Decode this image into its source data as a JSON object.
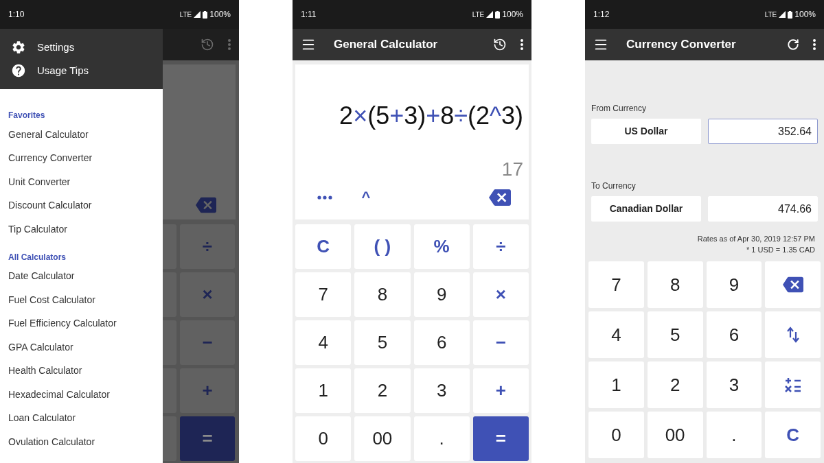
{
  "screens": [
    {
      "kind": "drawer",
      "status_bar": {
        "time": "1:10",
        "network": "LTE",
        "battery": "100%"
      },
      "drawer": {
        "top_items": [
          {
            "label": "Settings",
            "kind": "settings"
          },
          {
            "label": "Usage Tips",
            "kind": "help"
          }
        ],
        "sections": [
          {
            "heading": "Favorites",
            "items": [
              "General Calculator",
              "Currency Converter",
              "Unit Converter",
              "Discount Calculator",
              "Tip Calculator"
            ]
          },
          {
            "heading": "All Calculators",
            "items": [
              "Date Calculator",
              "Fuel Cost Calculator",
              "Fuel Efficiency Calculator",
              "GPA Calculator",
              "Health Calculator",
              "Hexadecimal Calculator",
              "Loan Calculator",
              "Ovulation Calculator"
            ]
          }
        ]
      },
      "background_keys": [
        {
          "label": "÷",
          "kind": "op"
        },
        {
          "label": "×",
          "kind": "op"
        },
        {
          "label": "−",
          "kind": "op"
        },
        {
          "label": "+",
          "kind": "op"
        },
        {
          "label": "=",
          "kind": "equals"
        }
      ]
    },
    {
      "kind": "calculator",
      "status_bar": {
        "time": "1:11",
        "network": "LTE",
        "battery": "100%"
      },
      "app_bar": {
        "title": "General Calculator",
        "kind": "history"
      },
      "display": {
        "expression": [
          {
            "text": "2",
            "kind": "num"
          },
          {
            "text": "×",
            "kind": "op"
          },
          {
            "text": "(5",
            "kind": "num"
          },
          {
            "text": "+",
            "kind": "op"
          },
          {
            "text": "3)",
            "kind": "num"
          },
          {
            "text": "+",
            "kind": "op"
          },
          {
            "text": "8",
            "kind": "num"
          },
          {
            "text": "÷",
            "kind": "op"
          },
          {
            "text": "(2",
            "kind": "num"
          },
          {
            "text": "^",
            "kind": "op"
          },
          {
            "text": "3)",
            "kind": "num"
          }
        ],
        "result": "17",
        "caret": "^"
      },
      "keypad": [
        [
          {
            "label": "C",
            "kind": "op"
          },
          {
            "label": "( )",
            "kind": "op"
          },
          {
            "label": "%",
            "kind": "op"
          },
          {
            "label": "÷",
            "kind": "op"
          }
        ],
        [
          {
            "label": "7",
            "kind": "digit"
          },
          {
            "label": "8",
            "kind": "digit"
          },
          {
            "label": "9",
            "kind": "digit"
          },
          {
            "label": "×",
            "kind": "op"
          }
        ],
        [
          {
            "label": "4",
            "kind": "digit"
          },
          {
            "label": "5",
            "kind": "digit"
          },
          {
            "label": "6",
            "kind": "digit"
          },
          {
            "label": "−",
            "kind": "op"
          }
        ],
        [
          {
            "label": "1",
            "kind": "digit"
          },
          {
            "label": "2",
            "kind": "digit"
          },
          {
            "label": "3",
            "kind": "digit"
          },
          {
            "label": "+",
            "kind": "op"
          }
        ],
        [
          {
            "label": "0",
            "kind": "digit"
          },
          {
            "label": "00",
            "kind": "digit"
          },
          {
            "label": ".",
            "kind": "digit"
          },
          {
            "label": "=",
            "kind": "equals"
          }
        ]
      ]
    },
    {
      "kind": "currency",
      "status_bar": {
        "time": "1:12",
        "network": "LTE",
        "battery": "100%"
      },
      "app_bar": {
        "title": "Currency Converter",
        "kind": "refresh"
      },
      "from": {
        "label": "From Currency",
        "currency": "US Dollar",
        "amount": "352.64",
        "focused": true
      },
      "to": {
        "label": "To Currency",
        "currency": "Canadian Dollar",
        "amount": "474.66",
        "focused": false
      },
      "rates": "Rates as of Apr 30, 2019 12:57 PM",
      "rate": "* 1 USD = 1.35 CAD",
      "keypad": [
        [
          {
            "label": "7",
            "kind": "digit"
          },
          {
            "label": "8",
            "kind": "digit"
          },
          {
            "label": "9",
            "kind": "digit"
          },
          {
            "kind": "backspace"
          }
        ],
        [
          {
            "label": "4",
            "kind": "digit"
          },
          {
            "label": "5",
            "kind": "digit"
          },
          {
            "label": "6",
            "kind": "digit"
          },
          {
            "kind": "swap"
          }
        ],
        [
          {
            "label": "1",
            "kind": "digit"
          },
          {
            "label": "2",
            "kind": "digit"
          },
          {
            "label": "3",
            "kind": "digit"
          },
          {
            "kind": "operations"
          }
        ],
        [
          {
            "label": "0",
            "kind": "digit"
          },
          {
            "label": "00",
            "kind": "digit"
          },
          {
            "label": ".",
            "kind": "digit"
          },
          {
            "label": "C",
            "kind": "op"
          }
        ]
      ]
    }
  ]
}
